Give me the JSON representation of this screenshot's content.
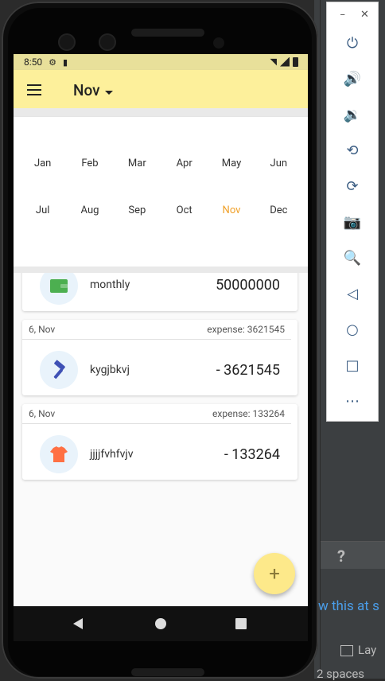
{
  "status_bar": {
    "time": "8:50"
  },
  "app_bar": {
    "title": "Nov"
  },
  "month_picker": {
    "months": [
      "Jan",
      "Feb",
      "Mar",
      "Apr",
      "May",
      "Jun",
      "Jul",
      "Aug",
      "Sep",
      "Oct",
      "Nov",
      "Dec"
    ],
    "selected": "Nov",
    "accent_color": "#f0a028"
  },
  "transactions": [
    {
      "date": "",
      "summary": "",
      "name": "monthly",
      "amount": "50000000",
      "icon": "wallet-icon",
      "icon_color": "#4caf50"
    },
    {
      "date": "6, Nov",
      "summary": "expense: 3621545",
      "name": "kygjbkvj",
      "amount": "- 3621545",
      "icon": "hammer-icon",
      "icon_color": "#3f51b5"
    },
    {
      "date": "6, Nov",
      "summary": "expense: 133264",
      "name": "jjjjfvhfvjv",
      "amount": "- 133264",
      "icon": "shirt-icon",
      "icon_color": "#ff7043"
    }
  ],
  "fab": {
    "label": "+"
  },
  "ide": {
    "help": "?",
    "link": "w this at s",
    "layout": "Lay",
    "spaces": "2 spaces"
  },
  "emulator_toolbar": {
    "items": [
      "power-icon",
      "volume-up-icon",
      "volume-down-icon",
      "rotate-left-icon",
      "rotate-right-icon",
      "camera-icon",
      "zoom-icon",
      "back-icon",
      "home-icon",
      "overview-icon",
      "more-icon"
    ]
  }
}
